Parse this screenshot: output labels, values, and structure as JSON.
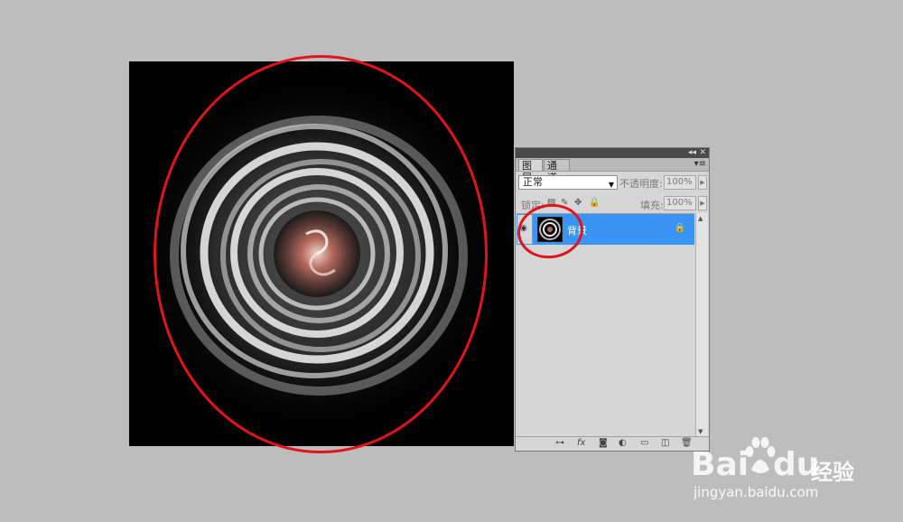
{
  "colors": {
    "workspace": "#bdbdbd",
    "selected_layer": "#3a94f4",
    "annotation_red": "#e2141a"
  },
  "panel": {
    "tabs": [
      "图层",
      "通道"
    ],
    "blend_mode": "正常",
    "opacity_label": "不透明度:",
    "opacity_value": "100%",
    "lock_label": "锁定:",
    "fill_label": "填充:",
    "fill_value": "100%",
    "layer_name": "背景",
    "bottom_icons": [
      "link-icon",
      "fx-icon",
      "mask-icon",
      "adjustment-icon",
      "folder-icon",
      "new-layer-icon",
      "trash-icon"
    ]
  },
  "watermark": {
    "brand_latin": "Bai",
    "brand_latin_2": "du",
    "brand_cn": "经验",
    "url": "jingyan.baidu.com"
  }
}
